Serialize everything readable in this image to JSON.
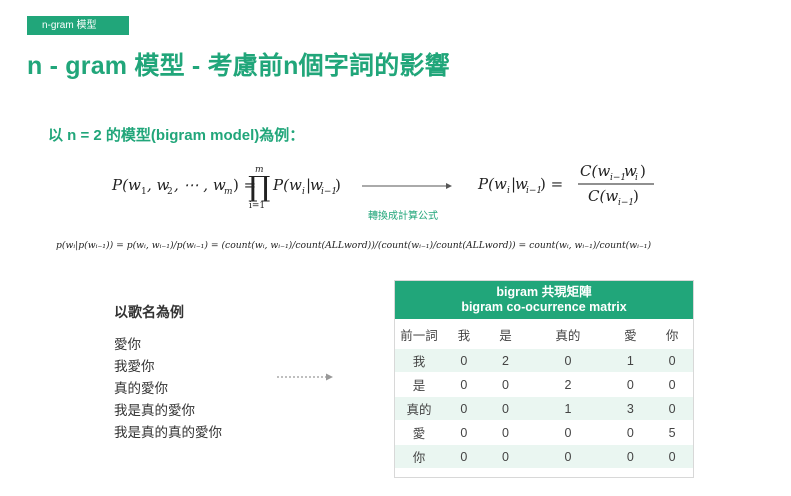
{
  "header": {
    "tag": "n-gram 模型",
    "title": "n - gram 模型 - 考慮前n個字詞的影響"
  },
  "subtitle": "以 n = 2 的模型(bigram model)為例：",
  "formulas": {
    "convert_label": "轉換成計算公式",
    "long_formula": "p(wᵢ|p(wᵢ₋₁)) = p(wᵢ, wᵢ₋₁)/p(wᵢ₋₁) = (count(wᵢ, wᵢ₋₁)/count(ALLword))/(count(wᵢ₋₁)/count(ALLword)) = count(wᵢ, wᵢ₋₁)/count(wᵢ₋₁)"
  },
  "example": {
    "title": "以歌名為例",
    "lines": [
      "愛你",
      "我愛你",
      "真的愛你",
      "我是真的愛你",
      "我是真的真的愛你"
    ]
  },
  "matrix": {
    "caption_line1": "bigram 共現矩陣",
    "caption_line2": "bigram co-ocurrence matrix",
    "headers": [
      "前一詞",
      "我",
      "是",
      "真的",
      "愛",
      "你"
    ],
    "rows": [
      {
        "label": "我",
        "values": [
          "0",
          "2",
          "0",
          "1",
          "0"
        ]
      },
      {
        "label": "是",
        "values": [
          "0",
          "0",
          "2",
          "0",
          "0"
        ]
      },
      {
        "label": "真的",
        "values": [
          "0",
          "0",
          "1",
          "3",
          "0"
        ]
      },
      {
        "label": "愛",
        "values": [
          "0",
          "0",
          "0",
          "0",
          "5"
        ]
      },
      {
        "label": "你",
        "values": [
          "0",
          "0",
          "0",
          "0",
          "0"
        ]
      }
    ]
  },
  "colors": {
    "accent": "#21a67a",
    "row_tint": "#eaf6f1"
  }
}
